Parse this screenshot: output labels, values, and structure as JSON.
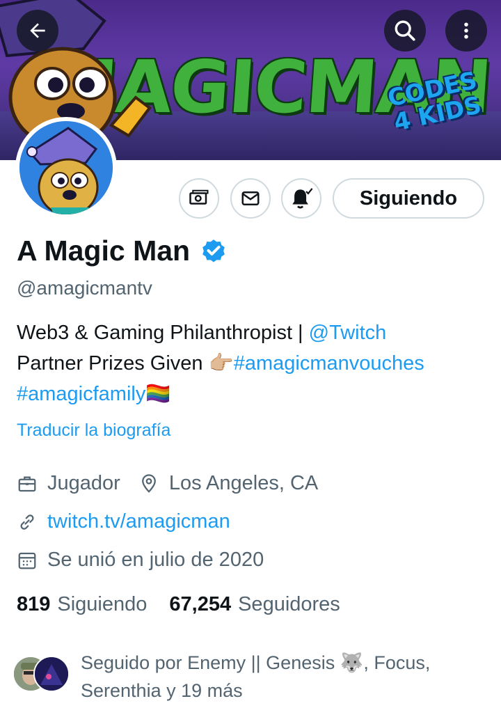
{
  "banner": {
    "title_art": "MAGICMAN",
    "badge_art_line1": "CODES",
    "badge_art_line2": "4 KIDS"
  },
  "header_buttons": {
    "back": "arrow-left-icon",
    "search": "search-icon",
    "more": "more-vertical-icon"
  },
  "actions": {
    "tip": "money-icon",
    "message": "mail-icon",
    "notifications": "bell-check-icon",
    "follow_label": "Siguiendo"
  },
  "profile": {
    "name": "A Magic Man",
    "handle": "@amagicmantv",
    "bio": {
      "part1": "Web3 & Gaming Philanthropist | ",
      "mention": "@Twitch",
      "part2": "Partner Prizes Given ",
      "emoji_point": "👉🏼",
      "hashtag1": "#amagicmanvouches",
      "hashtag2": "#amagicfamily",
      "emoji_flag": "🏳️‍🌈"
    },
    "translate_label": "Traducir la biografía",
    "category": "Jugador",
    "location": "Los Angeles, CA",
    "website": "twitch.tv/amagicman",
    "joined": "Se unió en julio de 2020"
  },
  "stats": {
    "following_count": "819",
    "following_label": "Siguiendo",
    "followers_count": "67,254",
    "followers_label": "Seguidores"
  },
  "followed_by": {
    "text": "Seguido por Enemy || Genesis 🐺, Focus, Serenthia y 19 más"
  },
  "colors": {
    "accent": "#1d9bf0",
    "text_primary": "#0f1419",
    "text_secondary": "#536471",
    "border": "#cfd9de"
  }
}
